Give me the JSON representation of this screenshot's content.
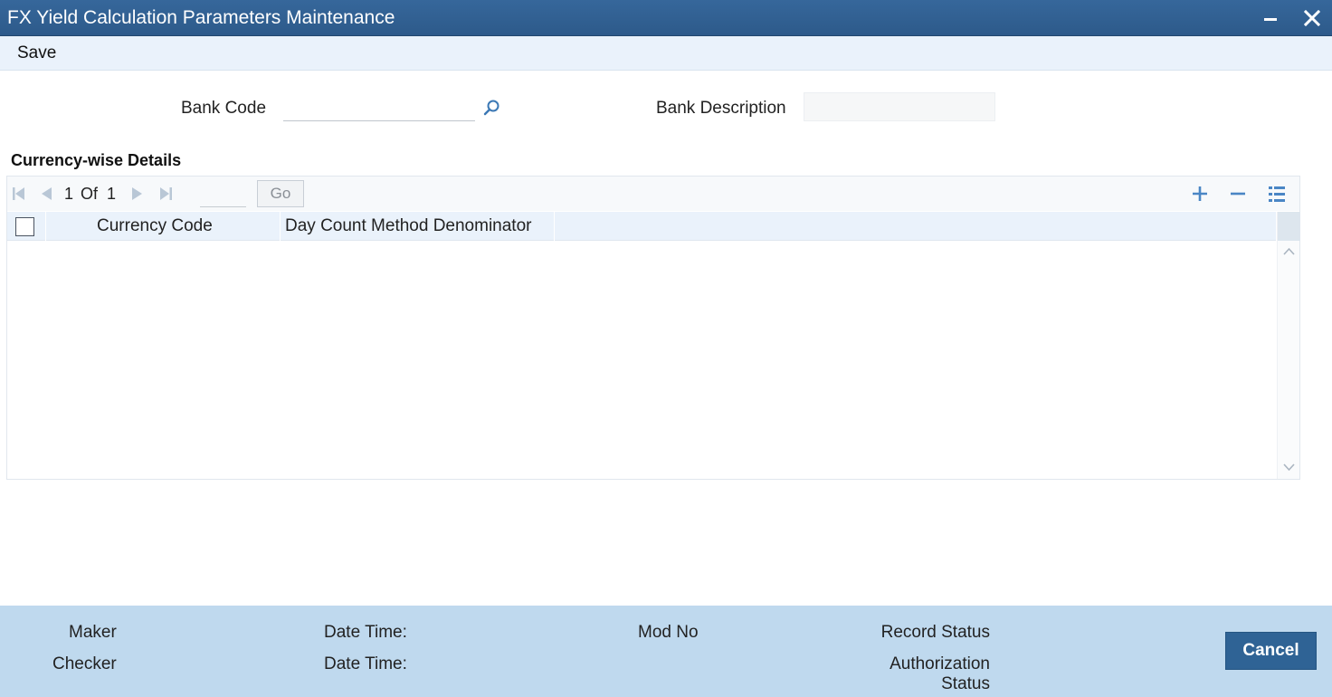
{
  "window": {
    "title": "FX Yield Calculation Parameters Maintenance",
    "minimize_icon": "minimize-icon",
    "close_icon": "close-icon"
  },
  "toolbar": {
    "save_label": "Save"
  },
  "form": {
    "bank_code_label": "Bank Code",
    "bank_code_value": "",
    "bank_description_label": "Bank Description",
    "bank_description_value": ""
  },
  "section": {
    "heading": "Currency-wise Details"
  },
  "grid": {
    "pagination": {
      "current": "1",
      "of_label": "Of",
      "total": "1",
      "go_label": "Go",
      "page_input": ""
    },
    "columns": [
      "Currency Code",
      "Day Count Method Denominator"
    ],
    "rows": [],
    "actions": [
      "add-row-icon",
      "delete-row-icon",
      "column-settings-icon"
    ]
  },
  "footer": {
    "maker_label": "Maker",
    "checker_label": "Checker",
    "date_time_label_1": "Date Time:",
    "date_time_label_2": "Date Time:",
    "mod_no_label": "Mod No",
    "record_status_label": "Record Status",
    "authorization_status_label": "Authorization Status",
    "cancel_label": "Cancel"
  },
  "colors": {
    "title_bar": "#2d5a8a",
    "toolbar_bg": "#eaf2fb",
    "footer_bg": "#bfd9ee",
    "cancel_button": "#2f6395",
    "icon_blue": "#4a86c5"
  }
}
